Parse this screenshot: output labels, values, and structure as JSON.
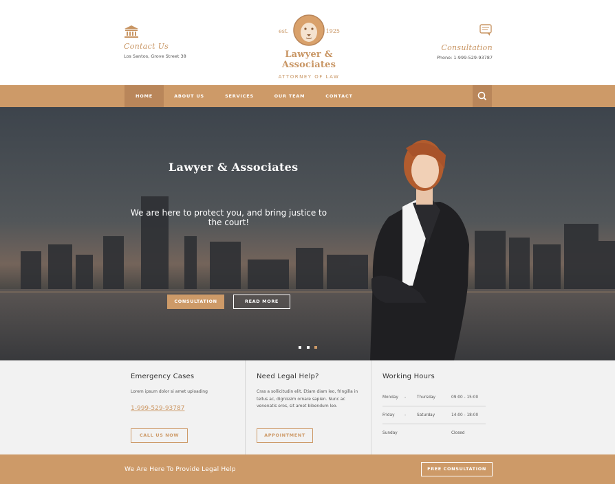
{
  "header": {
    "contact_title": "Contact Us",
    "contact_address": "Los Santos, Grove Street 38",
    "logo_est": "est.",
    "logo_year": "1925",
    "brand": "Lawyer & Associates",
    "tagline": "ATTORNEY OF LAW",
    "consult_title": "Consultation",
    "consult_phone": "Phone: 1-999-529-93787"
  },
  "nav": {
    "items": [
      "HOME",
      "ABOUT US",
      "SERVICES",
      "OUR TEAM",
      "CONTACT"
    ],
    "active_index": 0
  },
  "hero": {
    "title": "Lawyer & Associates",
    "subtitle": "We are here to protect you, and bring justice to the court!",
    "consultation_label": "CONSULTATION",
    "read_more_label": "READ MORE",
    "slide_count": 3,
    "active_slide": 2
  },
  "info": {
    "emergency": {
      "heading": "Emergency Cases",
      "text": "Lorem ipsum dolor si amet uploading",
      "phone": "1-999-529-93787",
      "button": "CALL US NOW"
    },
    "legal": {
      "heading": "Need Legal Help?",
      "text": "Cras a sollicitudin elit. Etiam diam leo, fringilla in tellus ac, dignissim ornare sapien. Nunc ac venenatis eros, sit amet bibendum leo.",
      "button": "APPOINTMENT"
    },
    "hours": {
      "heading": "Working Hours",
      "rows": [
        {
          "from": "Monday",
          "sep": "-",
          "to": "Thursday",
          "time": "09:00 - 15:00"
        },
        {
          "from": "Friday",
          "sep": "-",
          "to": "Saturday",
          "time": "14:00 - 18:00"
        },
        {
          "from": "Sunday",
          "sep": "",
          "to": "",
          "time": "Closed"
        }
      ]
    }
  },
  "bar": {
    "text": "We Are Here To Provide Legal Help",
    "button": "FREE CONSULTATION"
  },
  "colors": {
    "accent": "#cd9a68",
    "accent_dark": "#b9865a",
    "info_bg": "#f2f2f2"
  },
  "icons": {
    "contact": "courthouse-icon",
    "consultation": "speech-bubble-icon",
    "search": "search-icon",
    "logo": "lion-icon"
  }
}
